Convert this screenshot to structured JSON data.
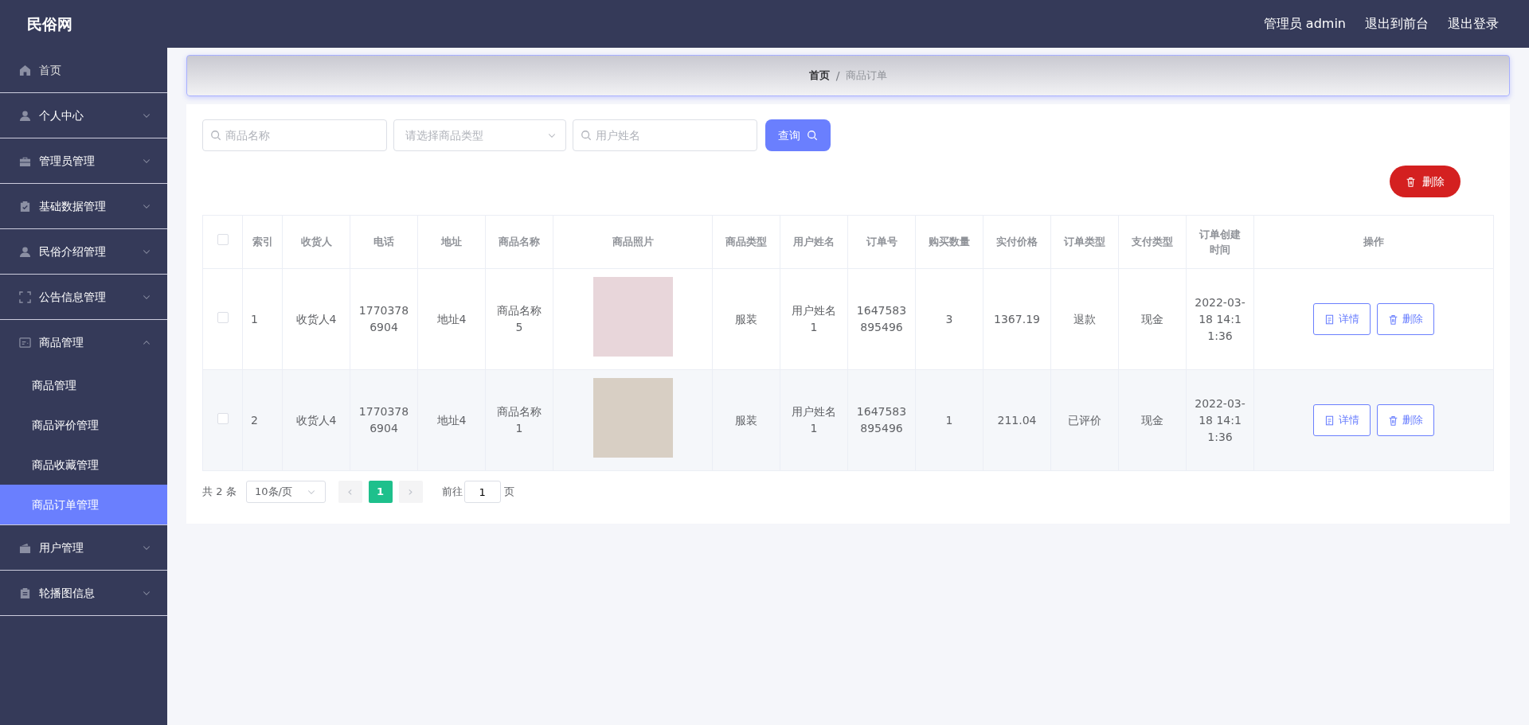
{
  "topbar": {
    "brand": "民俗网",
    "user_label": "管理员 admin",
    "links": [
      "退出到前台",
      "退出登录"
    ]
  },
  "sidebar": {
    "items": [
      {
        "label": "首页",
        "expandable": false,
        "expanded": false
      },
      {
        "label": "个人中心",
        "expandable": true,
        "expanded": false
      },
      {
        "label": "管理员管理",
        "expandable": true,
        "expanded": false
      },
      {
        "label": "基础数据管理",
        "expandable": true,
        "expanded": false
      },
      {
        "label": "民俗介绍管理",
        "expandable": true,
        "expanded": false
      },
      {
        "label": "公告信息管理",
        "expandable": true,
        "expanded": false
      },
      {
        "label": "商品管理",
        "expandable": true,
        "expanded": true,
        "children": [
          {
            "label": "商品管理",
            "selected": false
          },
          {
            "label": "商品评价管理",
            "selected": false
          },
          {
            "label": "商品收藏管理",
            "selected": false
          },
          {
            "label": "商品订单管理",
            "selected": true
          }
        ]
      },
      {
        "label": "用户管理",
        "expandable": true,
        "expanded": false
      },
      {
        "label": "轮播图信息",
        "expandable": true,
        "expanded": false
      }
    ]
  },
  "breadcrumb": {
    "items": [
      "首页",
      "商品订单"
    ],
    "separator": "/"
  },
  "filters": [
    {
      "kind": "search",
      "placeholder": "商品名称"
    },
    {
      "kind": "select",
      "placeholder": "请选择商品类型"
    },
    {
      "kind": "search",
      "placeholder": "用户姓名"
    }
  ],
  "query_button": "查询",
  "delete_button": "删除",
  "table": {
    "select_all_checked": false,
    "columns": [
      "索引",
      "收货人",
      "电话",
      "地址",
      "商品名称",
      "商品照片",
      "商品类型",
      "用户姓名",
      "订单号",
      "购买数量",
      "实付价格",
      "订单类型",
      "支付类型",
      "订单创建时间",
      "操作"
    ],
    "rows": [
      {
        "checked": false,
        "cells": [
          "1",
          "收货人4",
          "17703786904",
          "地址4",
          "商品名称5",
          "",
          "服装",
          "用户姓名1",
          "1647583895496",
          "3",
          "1367.19",
          "退款",
          "现金",
          "2022-03-18 14:11:36"
        ],
        "actions": [
          "详情",
          "删除"
        ]
      },
      {
        "checked": false,
        "cells": [
          "2",
          "收货人4",
          "17703786904",
          "地址4",
          "商品名称1",
          "",
          "服装",
          "用户姓名1",
          "1647583895496",
          "1",
          "211.04",
          "已评价",
          "现金",
          "2022-03-18 14:11:36"
        ],
        "actions": [
          "详情",
          "删除"
        ]
      }
    ]
  },
  "pagination": {
    "total": "共 2 条",
    "page_size": "10条/页",
    "prev": "‹",
    "pages": [
      {
        "label": "1",
        "selected": true
      }
    ],
    "next": "›",
    "goto_label": "前往",
    "goto_value": "1",
    "goto_suffix": "页"
  }
}
